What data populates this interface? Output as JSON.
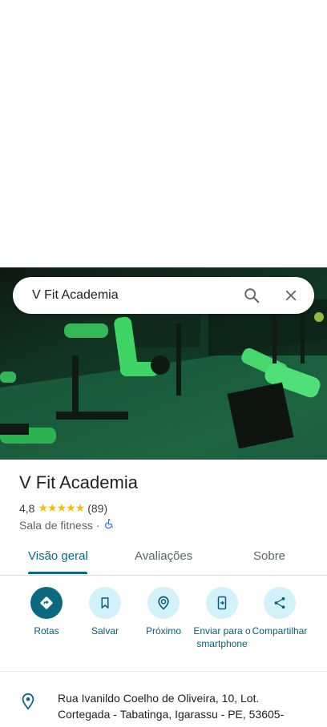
{
  "search": {
    "query": "V Fit Academia"
  },
  "place": {
    "name": "V Fit Academia",
    "rating": "4,8",
    "stars": "★★★★★",
    "review_count": "(89)",
    "category": "Sala de fitness",
    "separator": "·"
  },
  "tabs": [
    "Visão geral",
    "Avaliações",
    "Sobre"
  ],
  "actions": [
    {
      "label": "Rotas",
      "icon": "directions-icon"
    },
    {
      "label": "Salvar",
      "icon": "bookmark-icon"
    },
    {
      "label": "Próximo",
      "icon": "nearby-icon"
    },
    {
      "label": "Enviar para o smartphone",
      "icon": "send-to-phone-icon"
    },
    {
      "label": "Compartilhar",
      "icon": "share-icon"
    }
  ],
  "address": "Rua Ivanildo Coelho de Oliveira, 10, Lot. Cortegada - Tabatinga, Igarassu - PE, 53605-",
  "colors": {
    "accent": "#0b6a82",
    "action_bg": "#d2f1fb",
    "star": "#fbbc04"
  }
}
